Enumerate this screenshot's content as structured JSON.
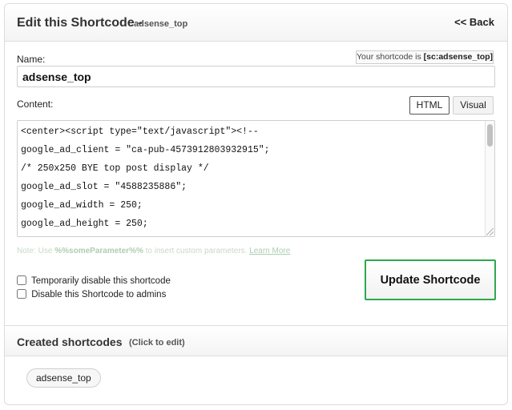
{
  "header": {
    "title": "Edit this Shortcode -",
    "subtitle": "adsense_top",
    "back_label": "<< Back"
  },
  "form": {
    "name_label": "Name:",
    "shortcode_hint_prefix": "Your shortcode is",
    "shortcode_hint_code": "[sc:adsense_top]",
    "name_value": "adsense_top",
    "content_label": "Content:",
    "tabs": [
      {
        "label": "HTML",
        "active": true
      },
      {
        "label": "Visual",
        "active": false
      }
    ],
    "code_lines": [
      "<center><script type=\"text/javascript\"><!--",
      "google_ad_client = \"ca-pub-4573912803932915\";",
      "/* 250x250 BYE top post display */",
      "google_ad_slot = \"4588235886\";",
      "google_ad_width = 250;",
      "google_ad_height = 250;"
    ],
    "note_prefix": "Note: Use",
    "note_param": "%%someParameter%%",
    "note_middle": "to insert custom parameters.",
    "note_link": "Learn More",
    "checkbox_disable_label": "Temporarily disable this shortcode",
    "checkbox_admins_label": "Disable this Shortcode to admins",
    "update_label": "Update Shortcode"
  },
  "created": {
    "title": "Created shortcodes",
    "hint": "(Click to edit)",
    "items": [
      "adsense_top"
    ]
  },
  "colors": {
    "update_border": "#2fa84f",
    "note_text": "#aecdb0"
  }
}
